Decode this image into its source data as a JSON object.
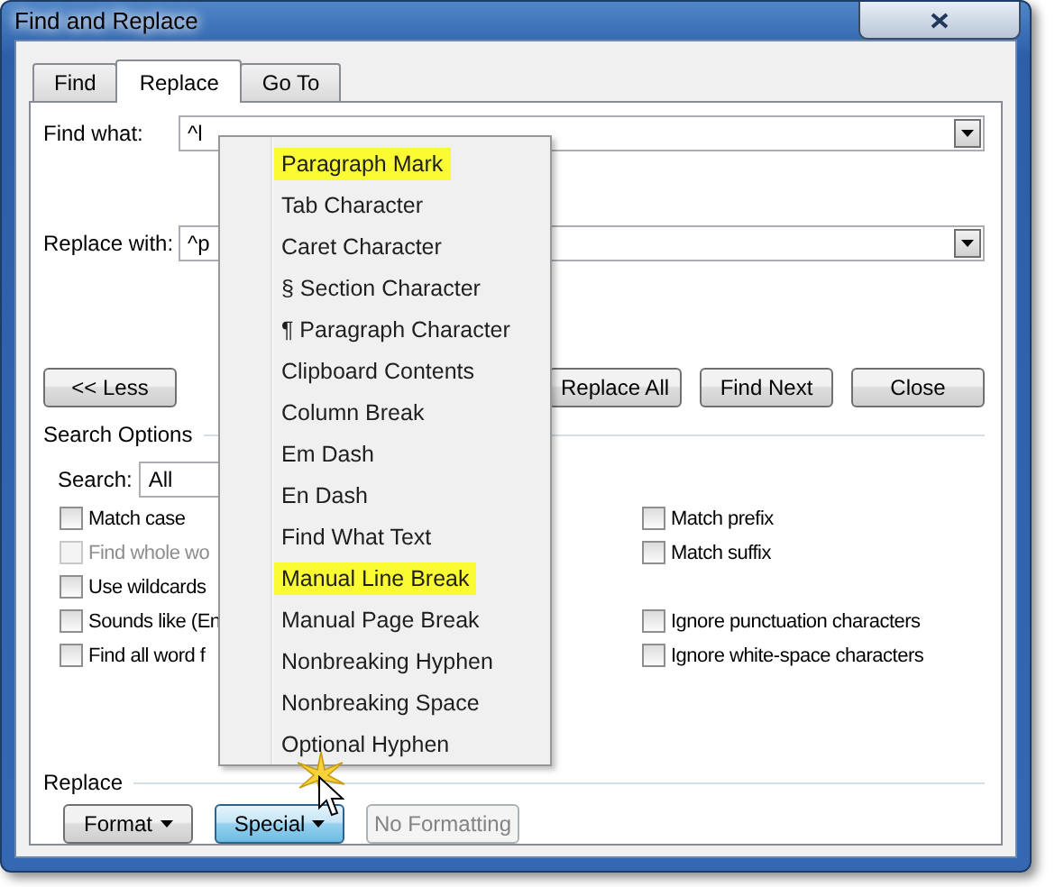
{
  "window": {
    "title": "Find and Replace"
  },
  "tabs": [
    {
      "label": "Find",
      "selected": false
    },
    {
      "label": "Replace",
      "selected": true
    },
    {
      "label": "Go To",
      "selected": false
    }
  ],
  "find_what": {
    "label": "Find what:",
    "value": "^l"
  },
  "replace_with": {
    "label": "Replace with:",
    "value": "^p"
  },
  "less_button": {
    "label": "<< Less"
  },
  "action_buttons": [
    {
      "label": "Replace All"
    },
    {
      "label": "Find Next"
    },
    {
      "label": "Close"
    }
  ],
  "search_options": {
    "heading": "Search Options",
    "search_label": "Search:",
    "search_value": "All",
    "left_options": [
      {
        "label": "Match case",
        "checked": false,
        "disabled": false
      },
      {
        "label": "Find whole wo",
        "checked": false,
        "disabled": true
      },
      {
        "label": "Use wildcards",
        "checked": false,
        "disabled": false
      },
      {
        "label": "Sounds like (En",
        "checked": false,
        "disabled": false
      },
      {
        "label": "Find all word f",
        "checked": false,
        "disabled": false
      }
    ],
    "right_option_groups": [
      [
        {
          "label": "Match prefix",
          "checked": false,
          "disabled": false
        },
        {
          "label": "Match suffix",
          "checked": false,
          "disabled": false
        }
      ],
      [
        {
          "label": "Ignore punctuation characters",
          "checked": false,
          "disabled": false
        },
        {
          "label": "Ignore white-space characters",
          "checked": false,
          "disabled": false
        }
      ]
    ]
  },
  "replace_section": {
    "heading": "Replace",
    "buttons": [
      {
        "label": "Format",
        "dropdown": true,
        "pressed": false,
        "disabled": false
      },
      {
        "label": "Special",
        "dropdown": true,
        "pressed": true,
        "disabled": false
      },
      {
        "label": "No Formatting",
        "dropdown": false,
        "pressed": false,
        "disabled": true
      }
    ]
  },
  "special_menu": [
    {
      "label": "Paragraph Mark",
      "highlighted": true
    },
    {
      "label": "Tab Character",
      "highlighted": false
    },
    {
      "label": "Caret Character",
      "highlighted": false
    },
    {
      "label": "§ Section Character",
      "highlighted": false
    },
    {
      "label": "¶ Paragraph Character",
      "highlighted": false
    },
    {
      "label": "Clipboard Contents",
      "highlighted": false
    },
    {
      "label": "Column Break",
      "highlighted": false
    },
    {
      "label": "Em Dash",
      "highlighted": false
    },
    {
      "label": "En Dash",
      "highlighted": false
    },
    {
      "label": "Find What Text",
      "highlighted": false
    },
    {
      "label": "Manual Line Break",
      "highlighted": true
    },
    {
      "label": "Manual Page Break",
      "highlighted": false
    },
    {
      "label": "Nonbreaking Hyphen",
      "highlighted": false
    },
    {
      "label": "Nonbreaking Space",
      "highlighted": false
    },
    {
      "label": "Optional Hyphen",
      "highlighted": false
    }
  ]
}
